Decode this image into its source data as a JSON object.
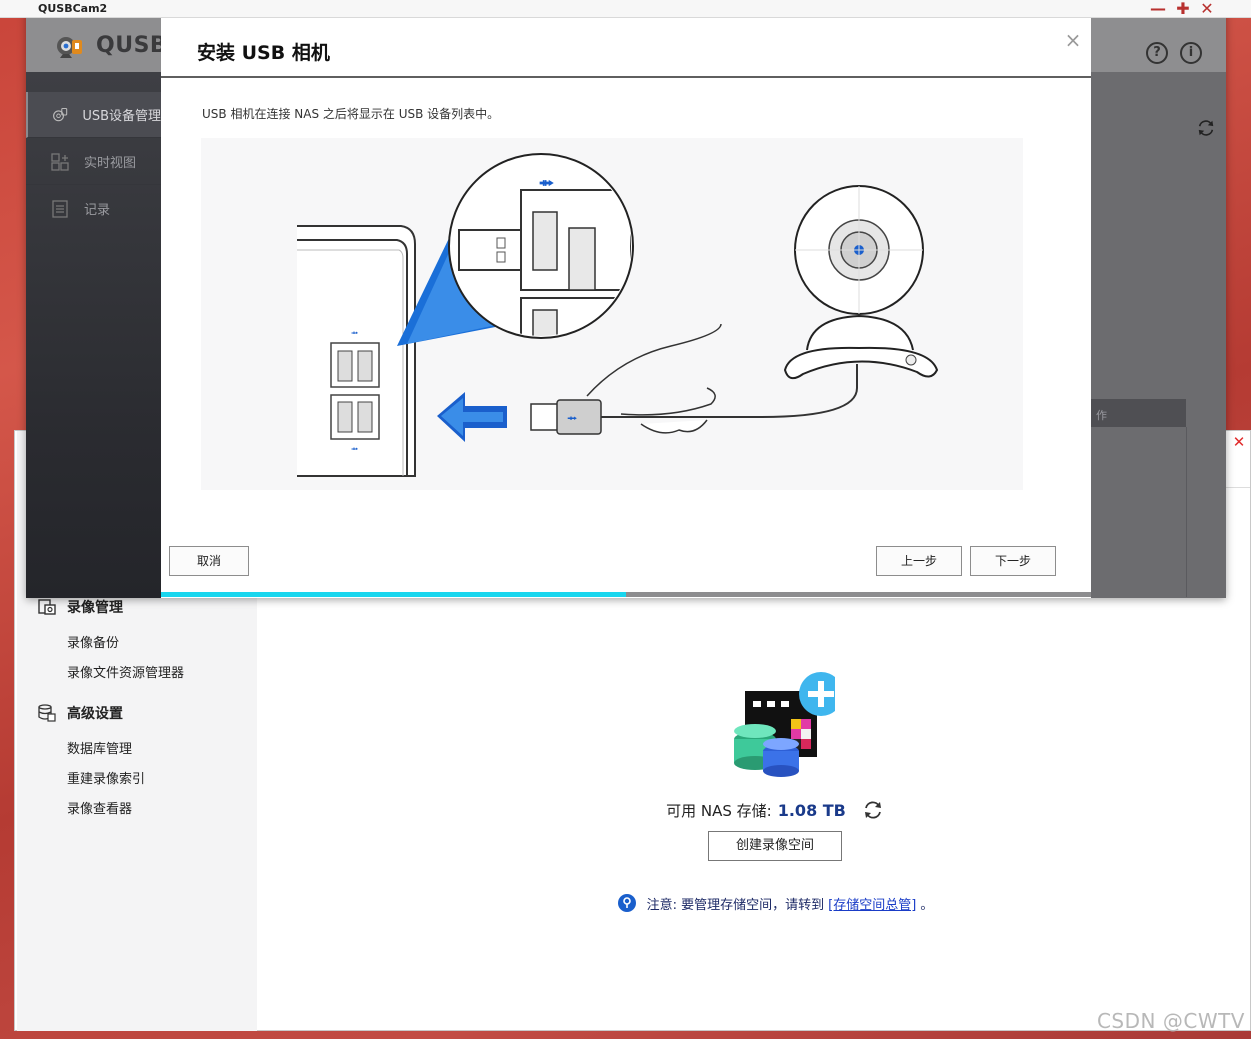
{
  "window": {
    "title": "QUSBCam2"
  },
  "app": {
    "logo_text": "QUSB"
  },
  "sidebar": {
    "items": [
      {
        "label": "USB设备管理",
        "icon": "webcam-icon"
      },
      {
        "label": "实时视图",
        "icon": "grid-icon"
      },
      {
        "label": "记录",
        "icon": "list-icon"
      }
    ]
  },
  "header_icons": [
    "help-icon",
    "info-icon"
  ],
  "modal": {
    "title": "安装 USB 相机",
    "description": "USB 相机在连接 NAS 之后将显示在 USB 设备列表中。",
    "cancel_label": "取消",
    "prev_label": "上一步",
    "next_label": "下一步",
    "progress_fraction": 0.5
  },
  "table": {
    "ops_header_fragment": "作"
  },
  "bg_sidebar": {
    "groups": [
      {
        "title": "录像管理",
        "items": [
          "录像备份",
          "录像文件资源管理器"
        ]
      },
      {
        "title": "高级设置",
        "items": [
          "数据库管理",
          "重建录像索引",
          "录像查看器"
        ]
      }
    ]
  },
  "bg_main": {
    "storage_label": "可用 NAS 存储:",
    "storage_value": "1.08 TB",
    "create_button": "创建录像空间",
    "note_prefix": "注意: 要管理存储空间，请转到",
    "note_link": "[存储空间总管]",
    "note_suffix": "。"
  },
  "watermark": "CSDN @CWTV",
  "colors": {
    "accent_cyan": "#18d6ee",
    "sidebar_dark": "#2a2b30",
    "brand_blue": "#1a5fcc",
    "storage_value_blue": "#1a3a8a"
  }
}
